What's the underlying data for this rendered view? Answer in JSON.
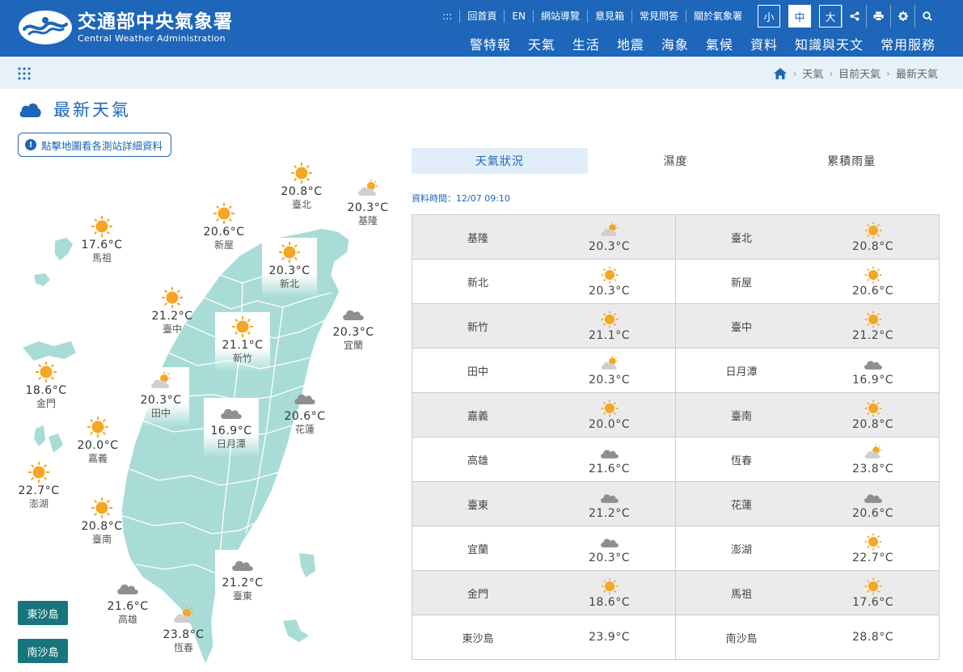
{
  "header": {
    "org_zh": "交通部中央氣象署",
    "org_en": "Central Weather Administration",
    "utility": [
      ":::",
      "回首頁",
      "EN",
      "網站導覽",
      "意見箱",
      "常見問答",
      "關於氣象署"
    ],
    "font_sizes": [
      "小",
      "中",
      "大"
    ],
    "font_size_active": "中",
    "tools": [
      "share-icon",
      "print-icon",
      "gear-icon",
      "search-icon"
    ],
    "nav": [
      "警特報",
      "天氣",
      "生活",
      "地震",
      "海象",
      "氣候",
      "資料",
      "知識與天文",
      "常用服務"
    ]
  },
  "breadcrumb": [
    "天氣",
    "目前天氣",
    "最新天氣"
  ],
  "page": {
    "title": "最新天氣",
    "map_note": "點擊地圖看各測站詳細資料"
  },
  "map": {
    "stations": [
      {
        "name": "臺北",
        "temp": "20.8°C",
        "icon": "sunny"
      },
      {
        "name": "基隆",
        "temp": "20.3°C",
        "icon": "partly-cloudy"
      },
      {
        "name": "新屋",
        "temp": "20.6°C",
        "icon": "sunny"
      },
      {
        "name": "馬祖",
        "temp": "17.6°C",
        "icon": "sunny"
      },
      {
        "name": "新北",
        "temp": "20.3°C",
        "icon": "sunny"
      },
      {
        "name": "臺中",
        "temp": "21.2°C",
        "icon": "sunny"
      },
      {
        "name": "宜蘭",
        "temp": "20.3°C",
        "icon": "cloudy"
      },
      {
        "name": "新竹",
        "temp": "21.1°C",
        "icon": "sunny"
      },
      {
        "name": "金門",
        "temp": "18.6°C",
        "icon": "sunny"
      },
      {
        "name": "田中",
        "temp": "20.3°C",
        "icon": "partly-cloudy"
      },
      {
        "name": "花蓮",
        "temp": "20.6°C",
        "icon": "cloudy"
      },
      {
        "name": "嘉義",
        "temp": "20.0°C",
        "icon": "sunny"
      },
      {
        "name": "日月潭",
        "temp": "16.9°C",
        "icon": "cloudy"
      },
      {
        "name": "澎湖",
        "temp": "22.7°C",
        "icon": "sunny"
      },
      {
        "name": "臺南",
        "temp": "20.8°C",
        "icon": "sunny"
      },
      {
        "name": "臺東",
        "temp": "21.2°C",
        "icon": "cloudy"
      },
      {
        "name": "高雄",
        "temp": "21.6°C",
        "icon": "cloudy"
      },
      {
        "name": "恆春",
        "temp": "23.8°C",
        "icon": "partly-cloudy"
      }
    ],
    "island_buttons": [
      "東沙島",
      "南沙島"
    ]
  },
  "tabs": [
    "天氣狀況",
    "濕度",
    "累積雨量"
  ],
  "active_tab": "天氣狀況",
  "data_time": "資料時間：12/07 09:10",
  "table": [
    [
      {
        "name": "基隆",
        "temp": "20.3°C",
        "icon": "partly-cloudy"
      },
      {
        "name": "臺北",
        "temp": "20.8°C",
        "icon": "sunny"
      }
    ],
    [
      {
        "name": "新北",
        "temp": "20.3°C",
        "icon": "sunny"
      },
      {
        "name": "新屋",
        "temp": "20.6°C",
        "icon": "sunny"
      }
    ],
    [
      {
        "name": "新竹",
        "temp": "21.1°C",
        "icon": "sunny"
      },
      {
        "name": "臺中",
        "temp": "21.2°C",
        "icon": "sunny"
      }
    ],
    [
      {
        "name": "田中",
        "temp": "20.3°C",
        "icon": "partly-cloudy"
      },
      {
        "name": "日月潭",
        "temp": "16.9°C",
        "icon": "cloudy"
      }
    ],
    [
      {
        "name": "嘉義",
        "temp": "20.0°C",
        "icon": "sunny"
      },
      {
        "name": "臺南",
        "temp": "20.8°C",
        "icon": "sunny"
      }
    ],
    [
      {
        "name": "高雄",
        "temp": "21.6°C",
        "icon": "cloudy"
      },
      {
        "name": "恆春",
        "temp": "23.8°C",
        "icon": "partly-cloudy"
      }
    ],
    [
      {
        "name": "臺東",
        "temp": "21.2°C",
        "icon": "cloudy"
      },
      {
        "name": "花蓮",
        "temp": "20.6°C",
        "icon": "cloudy"
      }
    ],
    [
      {
        "name": "宜蘭",
        "temp": "20.3°C",
        "icon": "cloudy"
      },
      {
        "name": "澎湖",
        "temp": "22.7°C",
        "icon": "sunny"
      }
    ],
    [
      {
        "name": "金門",
        "temp": "18.6°C",
        "icon": "sunny"
      },
      {
        "name": "馬祖",
        "temp": "17.6°C",
        "icon": "sunny"
      }
    ],
    [
      {
        "name": "東沙島",
        "temp": "23.9°C",
        "icon": ""
      },
      {
        "name": "南沙島",
        "temp": "28.8°C",
        "icon": ""
      }
    ]
  ],
  "colors": {
    "brand_blue": "#1d66b9",
    "map_fill": "#a9dcd6",
    "island_button": "#18757d",
    "sun": "#f5a623"
  }
}
